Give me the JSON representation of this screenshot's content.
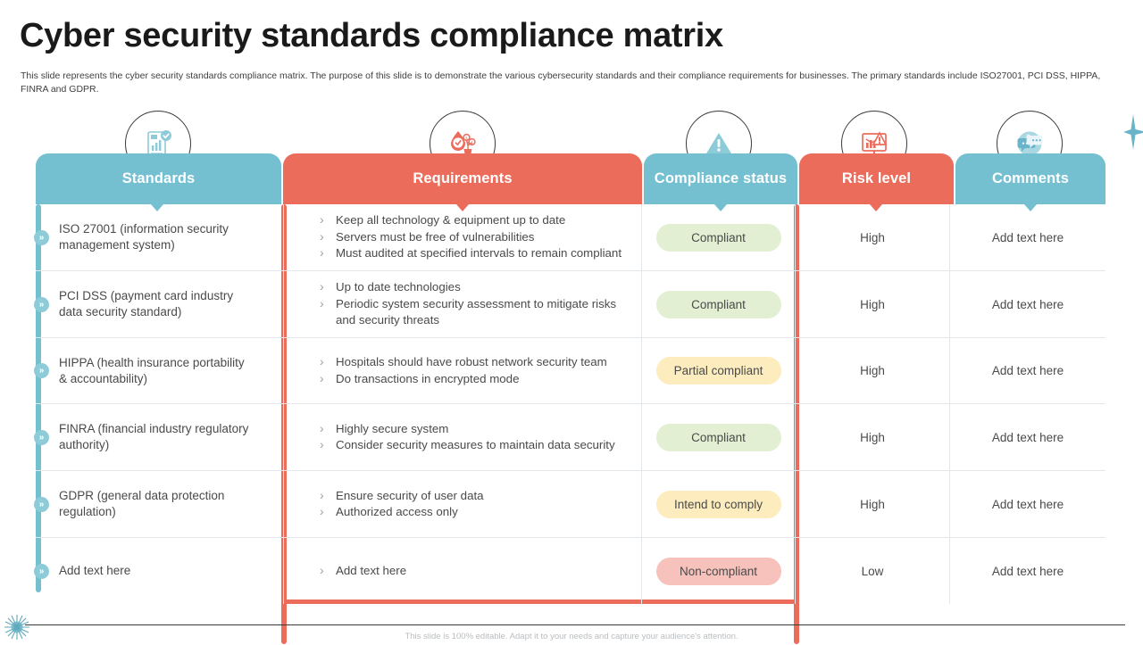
{
  "slide": {
    "title": "Cyber security standards compliance matrix",
    "subtitle": "This slide represents the cyber security standards compliance matrix. The purpose of this slide is to demonstrate the various cybersecurity standards and their compliance requirements for businesses. The primary standards include ISO27001, PCI DSS, HIPPA, FINRA and GDPR.",
    "footer_note": "This slide is 100% editable. Adapt it to your needs and capture your audience's attention."
  },
  "colors": {
    "blue": "#74c0d1",
    "red": "#ec6c5c",
    "green_pill": "#e2efd2",
    "yellow_pill": "#fcecbe",
    "pink_pill": "#f6c2bb",
    "divider": "#e3e7ea"
  },
  "table": {
    "columns": [
      {
        "label": "Standards",
        "accent": "blue",
        "icon": "report-check-icon"
      },
      {
        "label": "Requirements",
        "accent": "red",
        "icon": "requirements-icon"
      },
      {
        "label": "Compliance status",
        "accent": "blue",
        "icon": "warning-triangle-icon"
      },
      {
        "label": "Risk level",
        "accent": "red",
        "icon": "risk-monitor-icon"
      },
      {
        "label": "Comments",
        "accent": "blue",
        "icon": "chat-bubbles-icon"
      }
    ],
    "rows": [
      {
        "standard": "ISO 27001 (information security management system)",
        "requirements": [
          "Keep all technology & equipment up to date",
          "Servers must be free of vulnerabilities",
          "Must audited at specified intervals to remain compliant"
        ],
        "status": "Compliant",
        "status_style": "green",
        "risk": "High",
        "comments": "Add text here"
      },
      {
        "standard": "PCI DSS (payment card industry data security standard)",
        "requirements": [
          "Up to date technologies",
          "Periodic system security assessment to mitigate risks and security threats"
        ],
        "status": "Compliant",
        "status_style": "green",
        "risk": "High",
        "comments": "Add text here"
      },
      {
        "standard": "HIPPA (health insurance portability & accountability)",
        "requirements": [
          "Hospitals should have robust network security team",
          "Do transactions in encrypted mode"
        ],
        "status": "Partial compliant",
        "status_style": "yellow",
        "risk": "High",
        "comments": "Add text here"
      },
      {
        "standard": "FINRA (financial industry regulatory authority)",
        "requirements": [
          "Highly secure system",
          "Consider security measures to maintain data security"
        ],
        "status": "Compliant",
        "status_style": "green",
        "risk": "High",
        "comments": "Add text here"
      },
      {
        "standard": "GDPR (general data protection regulation)",
        "requirements": [
          "Ensure security of user data",
          "Authorized access only"
        ],
        "status": "Intend to comply",
        "status_style": "yellow",
        "risk": "High",
        "comments": "Add text here"
      },
      {
        "standard": "Add text here",
        "requirements": [
          "Add text here"
        ],
        "status": "Non-compliant",
        "status_style": "pink",
        "risk": "Low",
        "comments": "Add text here"
      }
    ]
  },
  "bullet_glyph": "»"
}
